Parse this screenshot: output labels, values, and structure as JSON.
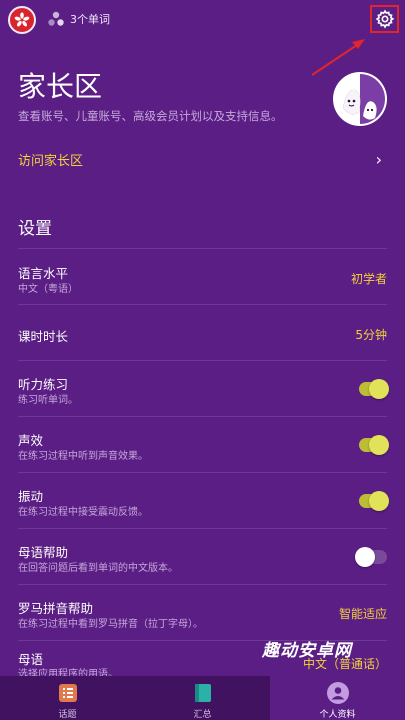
{
  "header": {
    "words_count": "3个单词"
  },
  "parent_zone": {
    "title": "家长区",
    "description": "查看账号、儿童账号、高级会员计划以及支持信息。",
    "visit_label": "访问家长区",
    "chevron": "›"
  },
  "settings": {
    "title": "设置",
    "rows": [
      {
        "label": "语言水平",
        "sub": "中文（粤语）",
        "value": "初学者"
      },
      {
        "label": "课时时长",
        "sub": "",
        "value": "5分钟"
      },
      {
        "label": "听力练习",
        "sub": "练习听单词。",
        "toggle": true
      },
      {
        "label": "声效",
        "sub": "在练习过程中听到声音效果。",
        "toggle": true
      },
      {
        "label": "振动",
        "sub": "在练习过程中接受震动反馈。",
        "toggle": true
      },
      {
        "label": "母语帮助",
        "sub": "在回答问题后看到单词的中文版本。",
        "toggle": false
      },
      {
        "label": "罗马拼音帮助",
        "sub": "在练习过程中看到罗马拼音（拉丁字母）。",
        "value": "智能适应"
      },
      {
        "label": "母语",
        "sub": "选择应用程序的用语。",
        "value": "中文（普通话）"
      }
    ]
  },
  "watermark": "趣动安卓网",
  "nav": {
    "items": [
      {
        "label": "话题",
        "icon": "topics-icon"
      },
      {
        "label": "汇总",
        "icon": "summary-icon"
      },
      {
        "label": "个人资料",
        "icon": "profile-icon",
        "active": true
      }
    ]
  },
  "colors": {
    "background": "#5a1e85",
    "accent_yellow": "#f4d13d",
    "toggle_on": "#e2e25a",
    "nav_background": "#40125f",
    "annotation_red": "#e0252d"
  }
}
